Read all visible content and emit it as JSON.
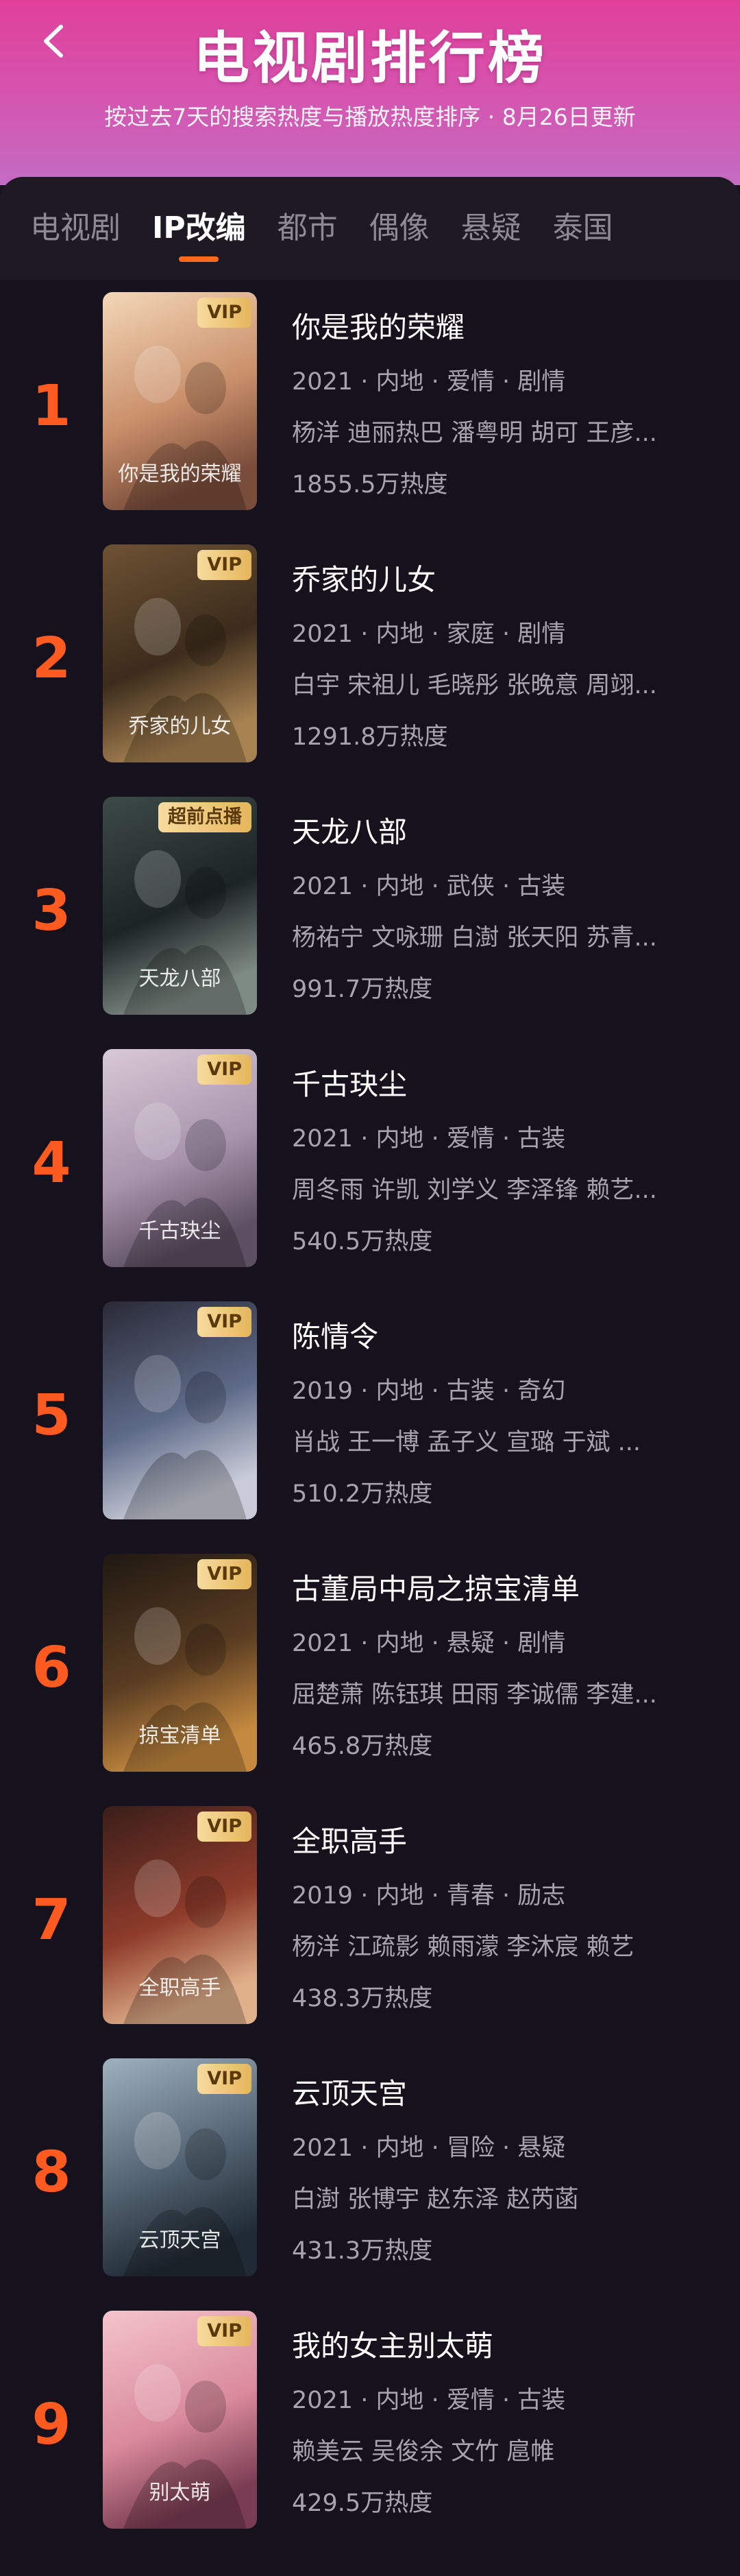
{
  "header": {
    "title": "电视剧排行榜",
    "subtitle": "按过去7天的搜索热度与播放热度排序 · 8月26日更新"
  },
  "tabs": [
    "电视剧",
    "IP改编",
    "都市",
    "偶像",
    "悬疑",
    "泰国"
  ],
  "active_tab": "IP改编",
  "items": [
    {
      "rank": "1",
      "badge": "VIP",
      "title": "你是我的荣耀",
      "meta": "2021 · 内地 · 爱情 · 剧情",
      "cast": "杨洋 迪丽热巴 潘粤明 胡可 王彦...",
      "heat": "1855.5万热度",
      "poster_text": "你是我的荣耀"
    },
    {
      "rank": "2",
      "badge": "VIP",
      "title": "乔家的儿女",
      "meta": "2021 · 内地 · 家庭 · 剧情",
      "cast": "白宇 宋祖儿 毛晓彤 张晚意 周翊...",
      "heat": "1291.8万热度",
      "poster_text": "乔家的儿女"
    },
    {
      "rank": "3",
      "badge": "超前点播",
      "title": "天龙八部",
      "meta": "2021 · 内地 · 武侠 · 古装",
      "cast": "杨祐宁 文咏珊 白澍 张天阳 苏青...",
      "heat": "991.7万热度",
      "poster_text": "天龙八部"
    },
    {
      "rank": "4",
      "badge": "VIP",
      "title": "千古玦尘",
      "meta": "2021 · 内地 · 爱情 · 古装",
      "cast": "周冬雨 许凯 刘学义 李泽锋 赖艺...",
      "heat": "540.5万热度",
      "poster_text": "千古玦尘"
    },
    {
      "rank": "5",
      "badge": "VIP",
      "title": "陈情令",
      "meta": "2019 · 内地 · 古装 · 奇幻",
      "cast": "肖战 王一博 孟子义 宣璐 于斌 ...",
      "heat": "510.2万热度",
      "poster_text": ""
    },
    {
      "rank": "6",
      "badge": "VIP",
      "title": "古董局中局之掠宝清单",
      "meta": "2021 · 内地 · 悬疑 · 剧情",
      "cast": "屈楚萧 陈钰琪 田雨 李诚儒 李建...",
      "heat": "465.8万热度",
      "poster_text": "掠宝清单"
    },
    {
      "rank": "7",
      "badge": "VIP",
      "title": "全职高手",
      "meta": "2019 · 内地 · 青春 · 励志",
      "cast": "杨洋 江疏影 赖雨濛 李沐宸 赖艺",
      "heat": "438.3万热度",
      "poster_text": "全职高手"
    },
    {
      "rank": "8",
      "badge": "VIP",
      "title": "云顶天宫",
      "meta": "2021 · 内地 · 冒险 · 悬疑",
      "cast": "白澍 张博宇 赵东泽 赵芮菡",
      "heat": "431.3万热度",
      "poster_text": "云顶天宫"
    },
    {
      "rank": "9",
      "badge": "VIP",
      "title": "我的女主别太萌",
      "meta": "2021 · 内地 · 爱情 · 古装",
      "cast": "赖美云 吴俊余 文竹 扈帷",
      "heat": "429.5万热度",
      "poster_text": "别太萌"
    }
  ],
  "icons": {
    "back": "back-arrow-icon"
  },
  "colors": {
    "accent": "#ff5a1f",
    "header_pink": "#e0409a",
    "background": "#16121d"
  }
}
